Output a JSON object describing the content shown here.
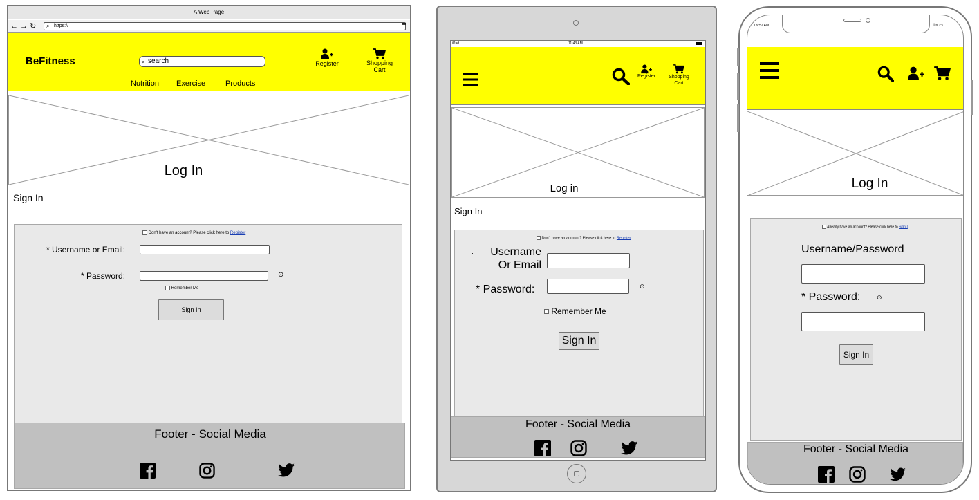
{
  "desktop": {
    "window_title": "A Web Page",
    "url": "https://",
    "brand": "BeFitness",
    "search_placeholder": "search",
    "nav": [
      "Nutrition",
      "Exercise",
      "Products"
    ],
    "register_label": "Register",
    "cart_label_1": "Shopping",
    "cart_label_2": "Cart",
    "hero_title": "Log In",
    "section_title": "Sign In",
    "account_prompt": "Don't have an account? Please click here to",
    "register_link": "Register",
    "username_label": "* Username or Email:",
    "password_label": "* Password:",
    "remember_label": "Remember Me",
    "signin_button": "Sign In",
    "footer_title": "Footer - Social Media"
  },
  "tablet": {
    "status_left": "iPad",
    "status_time": "11:43 AM",
    "register_label": "Register",
    "cart_label_1": "Shopping",
    "cart_label_2": "Cart",
    "hero_title": "Log in",
    "section_title": "Sign In",
    "account_prompt": "Don't have an account? Please click here to",
    "register_link": "Register",
    "username_label_1": "Username",
    "username_label_2": "Or Email",
    "password_label": "* Password:",
    "remember_label": "Remember Me",
    "signin_button": "Sign In",
    "footer_title": "Footer - Social Media"
  },
  "phone": {
    "status_time": "09:52 AM",
    "hero_title": "Log In",
    "account_prompt": "Already have an account? Please click here to",
    "signin_link": "Sign I",
    "username_label": "Username/Password",
    "password_label": "* Password:",
    "signin_button": "Sign In",
    "footer_title": "Footer - Social Media"
  },
  "colors": {
    "header": "#ffff00",
    "panel": "#e9e9e9",
    "footer": "#c0c0c0",
    "link": "#1a3fb3"
  },
  "icons": [
    "menu-icon",
    "search-icon",
    "add-user-icon",
    "cart-icon",
    "facebook-icon",
    "instagram-icon",
    "twitter-icon",
    "help-icon"
  ]
}
